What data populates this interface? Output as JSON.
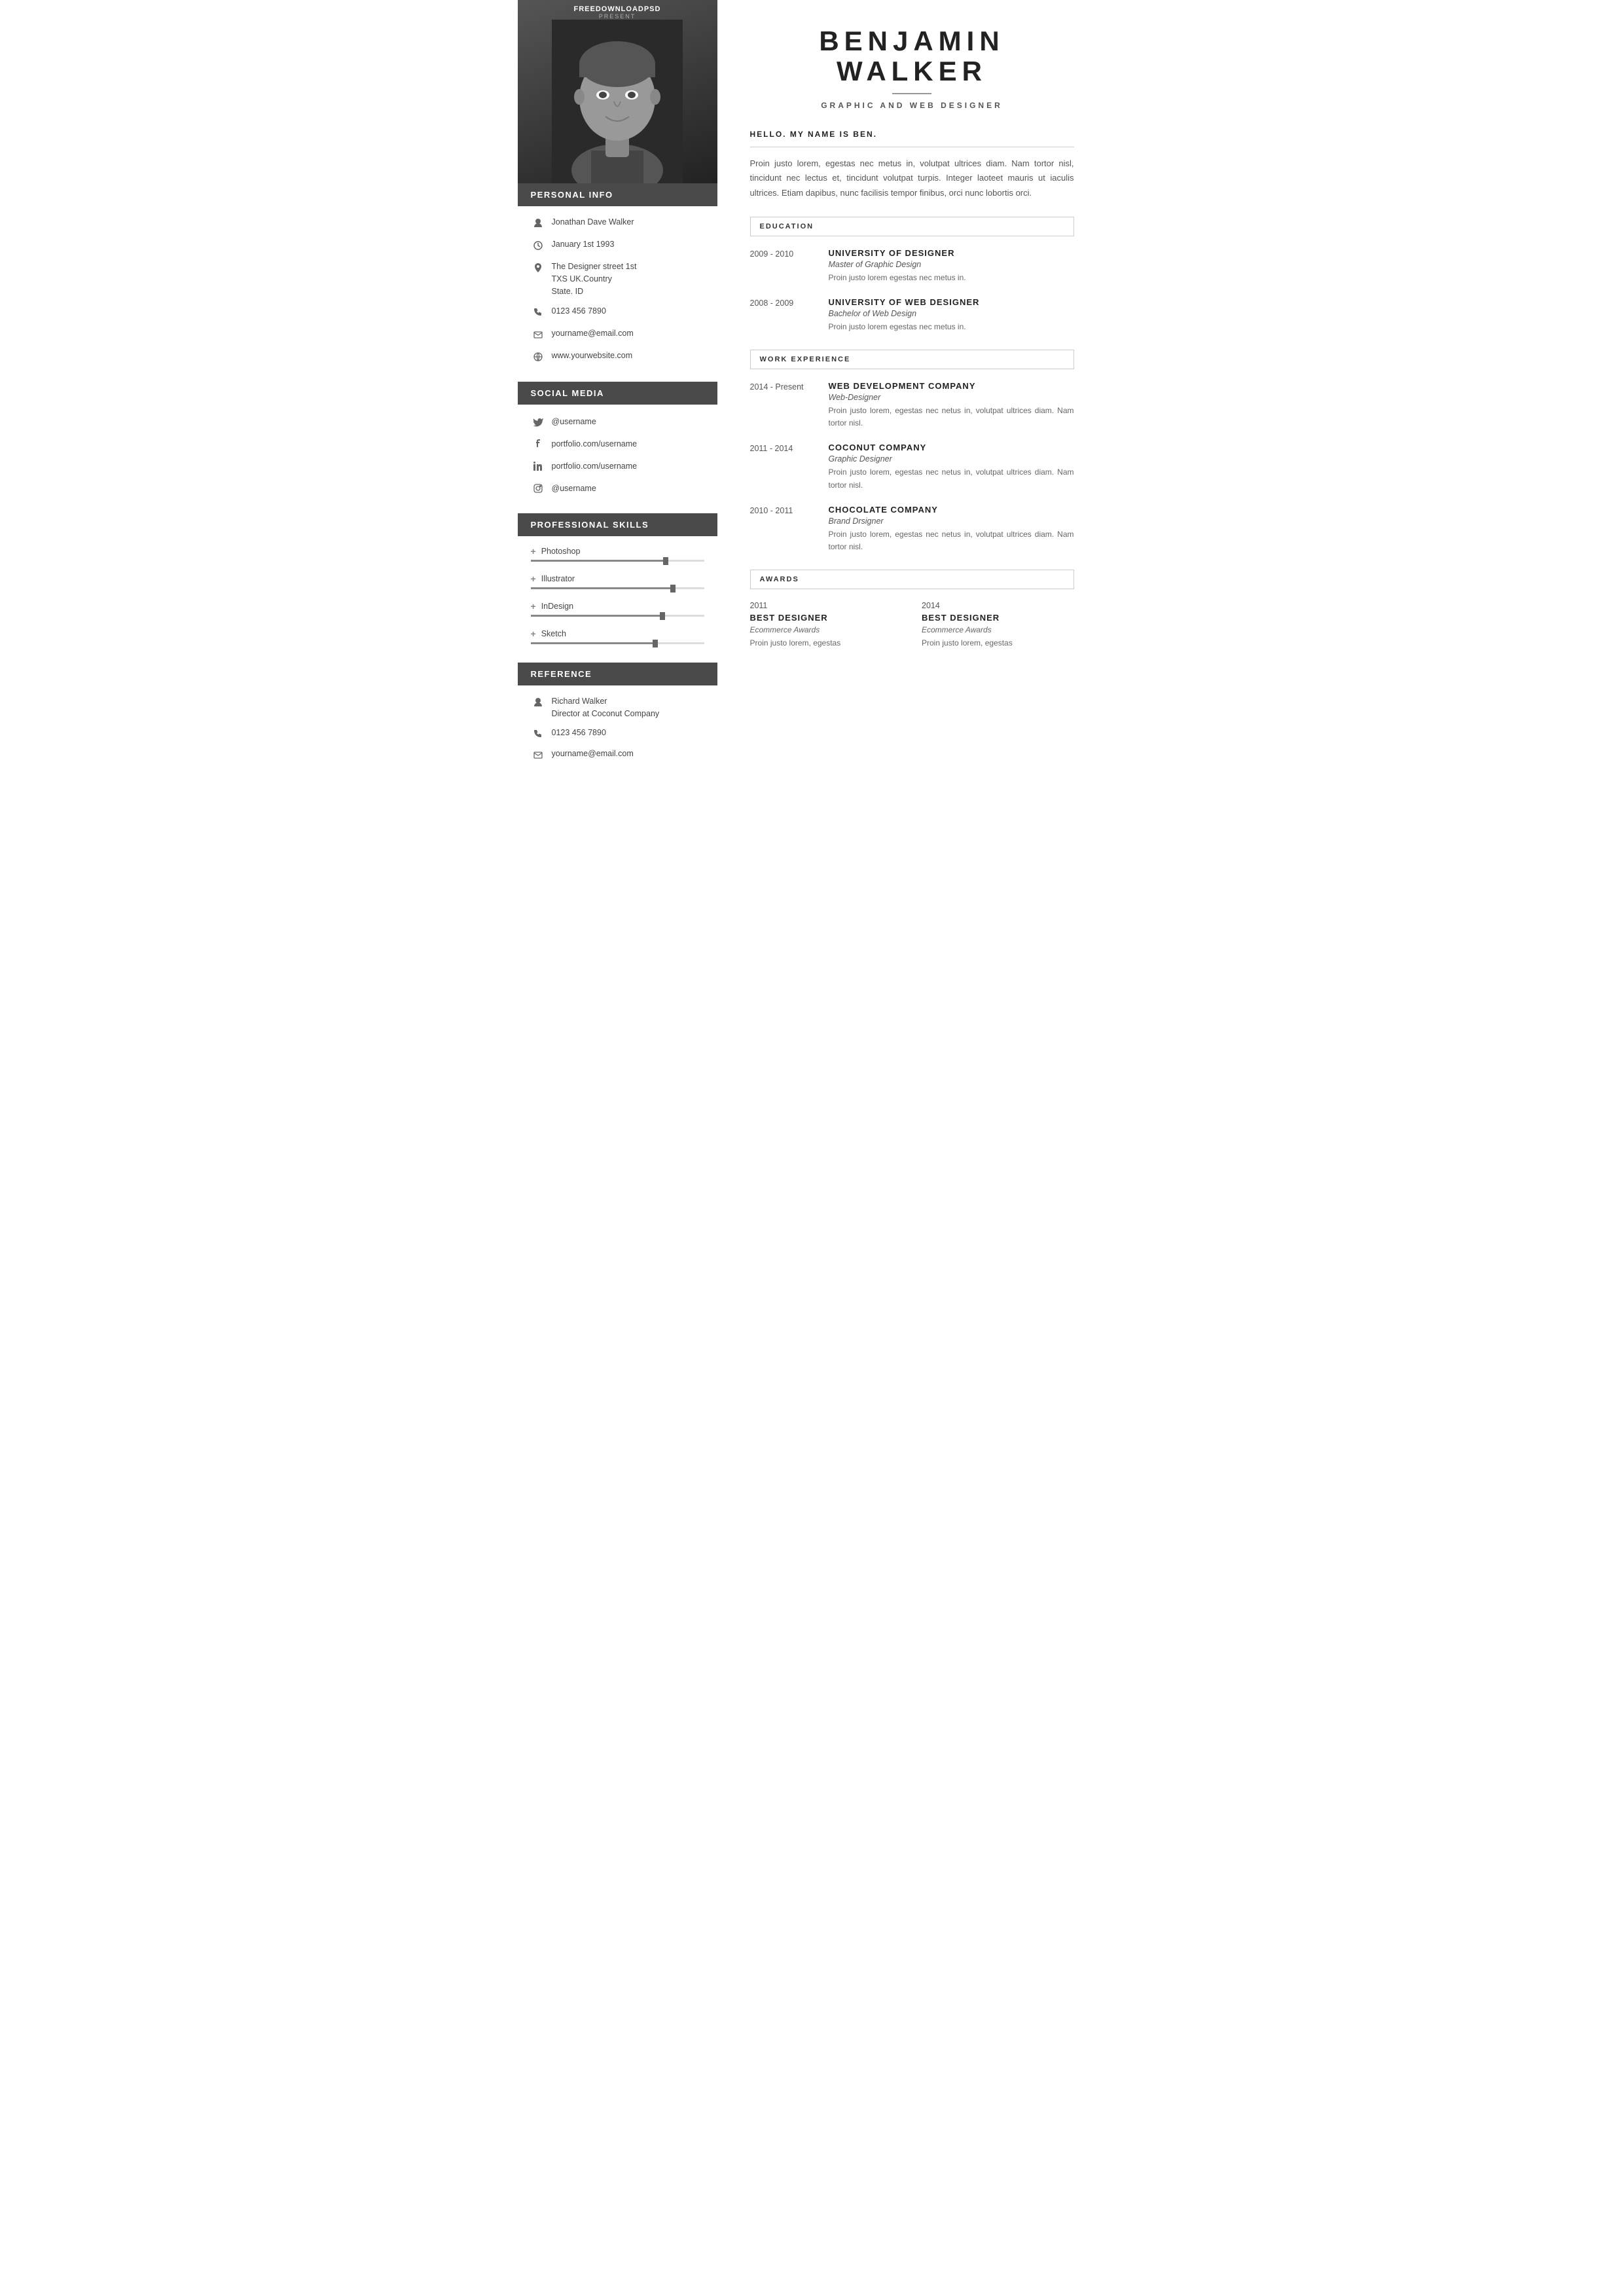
{
  "logo": {
    "brand": "FREEDOWNLOADPSD",
    "suffix": "⚡",
    "present": "PRESENT"
  },
  "sidebar": {
    "personal_info_label": "PERSONAL INFO",
    "name": "Jonathan Dave Walker",
    "birthday": "January 1st 1993",
    "address": "The Designer street 1st\nTXS UK.Country\nState. ID",
    "phone": "0123 456 7890",
    "email": "yourname@email.com",
    "website": "www.yourwebsite.com",
    "social_media_label": "SOCIAL MEDIA",
    "twitter": "@username",
    "facebook": "portfolio.com/username",
    "linkedin": "portfolio.com/username",
    "instagram": "@username",
    "skills_label": "PROFESSIONAL  SKILLS",
    "skills": [
      {
        "name": "Photoshop",
        "level": 78
      },
      {
        "name": "Illustrator",
        "level": 82
      },
      {
        "name": "InDesign",
        "level": 76
      },
      {
        "name": "Sketch",
        "level": 72
      }
    ],
    "reference_label": "REFERENCE",
    "ref_name": "Richard Walker",
    "ref_title": "Director at Coconut Company",
    "ref_phone": "0123 456 7890",
    "ref_email": "yourname@email.com"
  },
  "main": {
    "first_name": "BENJAMIN",
    "last_name": "WALKER",
    "job_title": "GRAPHIC AND WEB DESIGNER",
    "greeting": "HELLO. MY NAME IS BEN.",
    "intro": "Proin justo lorem, egestas nec metus in, volutpat ultrices diam. Nam tortor nisl, tincidunt nec lectus et, tincidunt volutpat turpis. Integer laoteet mauris ut iaculis ultrices. Etiam dapibus, nunc facilisis tempor finibus, orci nunc lobortis orci.",
    "education_label": "EDUCATION",
    "education": [
      {
        "years": "2009 - 2010",
        "institution": "UNIVERSITY OF DESIGNER",
        "degree": "Master of Graphic Design",
        "desc": "Proin justo lorem egestas nec metus in."
      },
      {
        "years": "2008 - 2009",
        "institution": "UNIVERSITY OF WEB DESIGNER",
        "degree": "Bachelor of Web Design",
        "desc": "Proin justo lorem egestas nec metus in."
      }
    ],
    "work_label": "WORK EXPERIENCE",
    "work": [
      {
        "years": "2014 - Present",
        "company": "WEB DEVELOPMENT COMPANY",
        "role": "Web-Designer",
        "desc": "Proin justo lorem, egestas nec netus in, volutpat ultrices diam. Nam tortor nisl."
      },
      {
        "years": "2011 - 2014",
        "company": "COCONUT COMPANY",
        "role": "Graphic Designer",
        "desc": "Proin justo lorem, egestas nec netus in, volutpat ultrices diam. Nam tortor nisl."
      },
      {
        "years": "2010 - 2011",
        "company": "CHOCOLATE  COMPANY",
        "role": "Brand Drsigner",
        "desc": "Proin justo lorem, egestas nec netus in, volutpat ultrices diam. Nam tortor nisl."
      }
    ],
    "awards_label": "AWARDS",
    "awards": [
      {
        "year": "2011",
        "title": "BEST  DESIGNER",
        "source": "Ecommerce Awards",
        "desc": "Proin justo lorem, egestas"
      },
      {
        "year": "2014",
        "title": "BEST  DESIGNER",
        "source": "Ecommerce Awards",
        "desc": "Proin justo lorem, egestas"
      }
    ]
  }
}
